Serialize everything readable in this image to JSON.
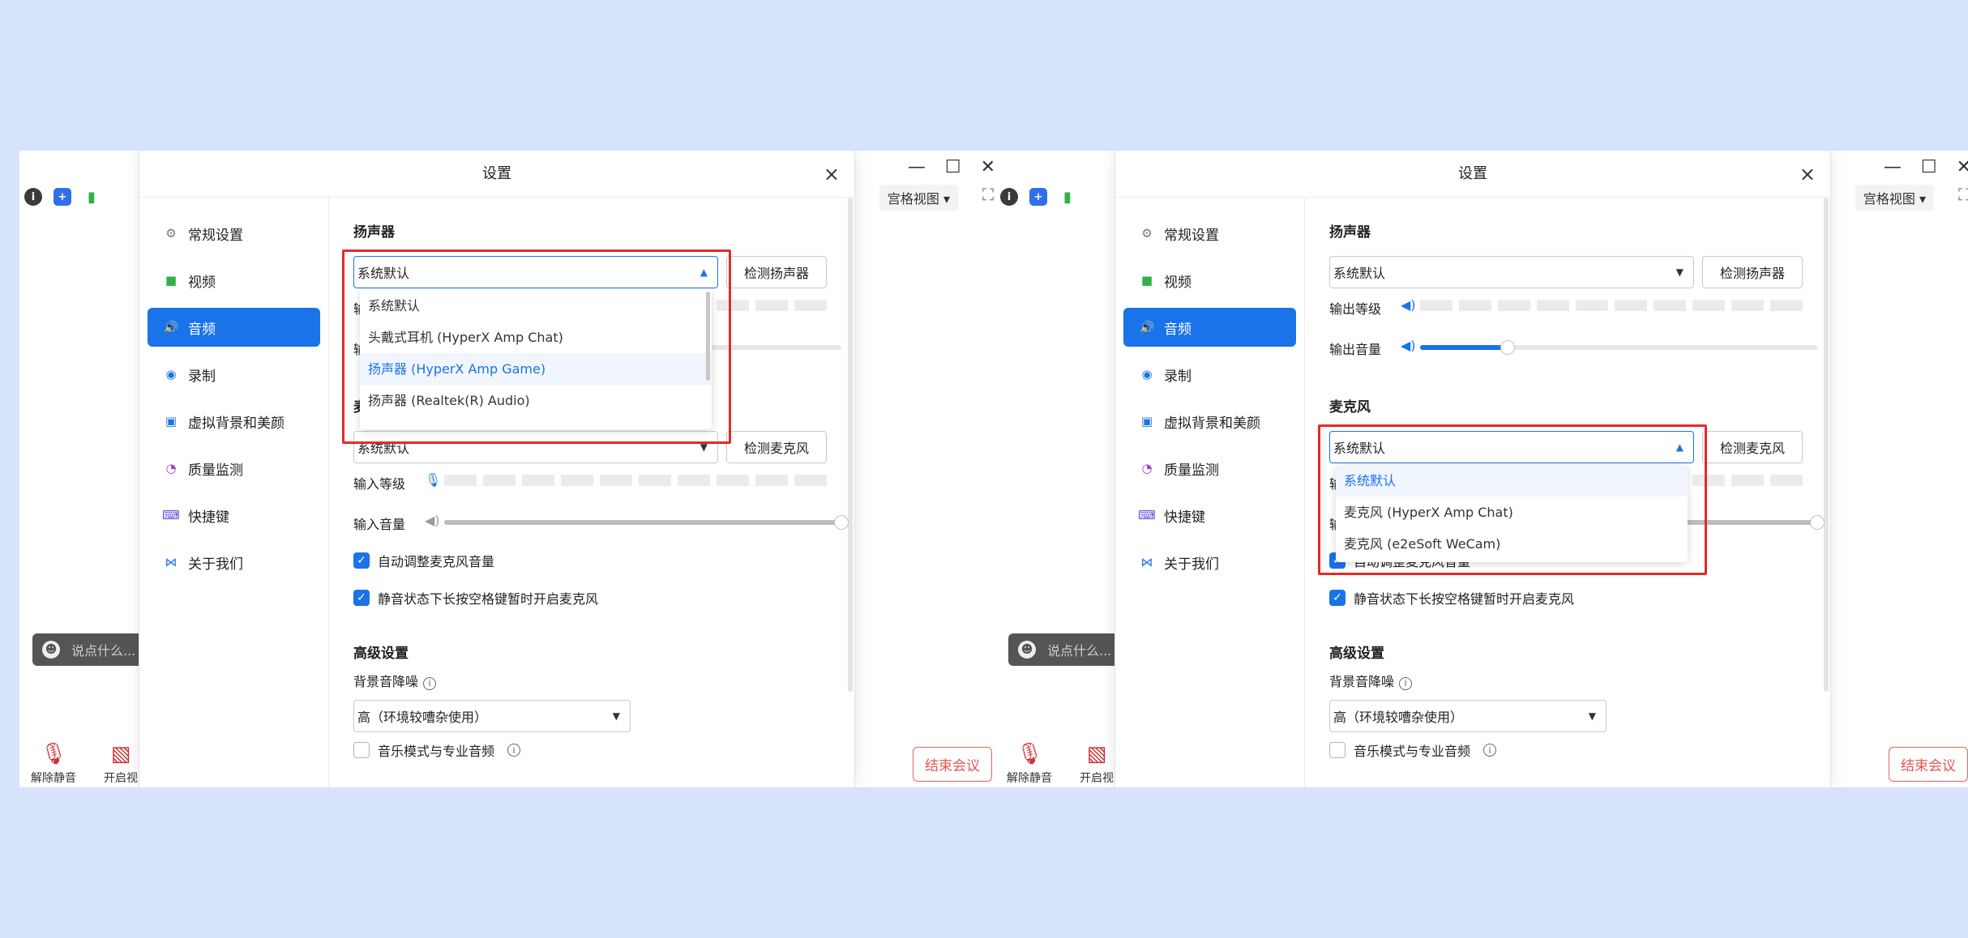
{
  "screens": [
    {
      "id": "left",
      "dialog_title": "设置",
      "close_label": "×",
      "sidebar": [
        "常规设置",
        "视频",
        "音频",
        "录制",
        "虚拟背景和美颜",
        "质量监测",
        "快捷键",
        "关于我们"
      ],
      "active_index": 2,
      "speaker_title": "扬声器",
      "speaker_value": "系统默认",
      "speaker_test": "检测扬声器",
      "output_level_label": "输出等级",
      "output_volume_label": "输出音量",
      "output_volume": 0.22,
      "mic_title": "麦克风",
      "mic_value": "系统默认",
      "mic_test": "检测麦克风",
      "input_level_label": "输入等级",
      "input_volume_label": "输入音量",
      "input_volume": 1.0,
      "auto_adjust": "自动调整麦克风音量",
      "space_unmute": "静音状态下长按空格键暂时开启麦克风",
      "advanced_title": "高级设置",
      "noise_label": "背景音降噪",
      "noise_value": "高（环境较嘈杂使用）",
      "music_mode": "音乐模式与专业音频",
      "dropdown_for": "speaker",
      "dropdown": [
        "系统默认",
        "头戴式耳机 (HyperX Amp Chat)",
        "扬声器 (HyperX Amp Game)",
        "扬声器 (Realtek(R) Audio)"
      ],
      "dropdown_highlight": 2,
      "meeting": {
        "grid_view": "宫格视图",
        "chat_placeholder": "说点什么...",
        "unmute": "解除静音",
        "start_video": "开启视",
        "end_meeting": "结束会议"
      }
    },
    {
      "id": "right",
      "dialog_title": "设置",
      "close_label": "×",
      "sidebar": [
        "常规设置",
        "视频",
        "音频",
        "录制",
        "虚拟背景和美颜",
        "质量监测",
        "快捷键",
        "关于我们"
      ],
      "active_index": 2,
      "speaker_title": "扬声器",
      "speaker_value": "系统默认",
      "speaker_test": "检测扬声器",
      "output_level_label": "输出等级",
      "output_volume_label": "输出音量",
      "output_volume": 0.22,
      "mic_title": "麦克风",
      "mic_value": "系统默认",
      "mic_test": "检测麦克风",
      "input_level_label": "输入等级",
      "input_volume_label": "输入音量",
      "input_volume": 1.0,
      "auto_adjust": "自动调整麦克风音量",
      "space_unmute": "静音状态下长按空格键暂时开启麦克风",
      "advanced_title": "高级设置",
      "noise_label": "背景音降噪",
      "noise_value": "高（环境较嘈杂使用）",
      "music_mode": "音乐模式与专业音频",
      "dropdown_for": "mic",
      "dropdown": [
        "系统默认",
        "麦克风 (HyperX Amp Chat)",
        "麦克风 (e2eSoft WeCam)"
      ],
      "dropdown_highlight": 0,
      "meeting": {
        "grid_view": "宫格视图",
        "chat_placeholder": "说点什么...",
        "unmute": "解除静音",
        "start_video": "开启视",
        "end_meeting": "结束会议"
      }
    }
  ]
}
